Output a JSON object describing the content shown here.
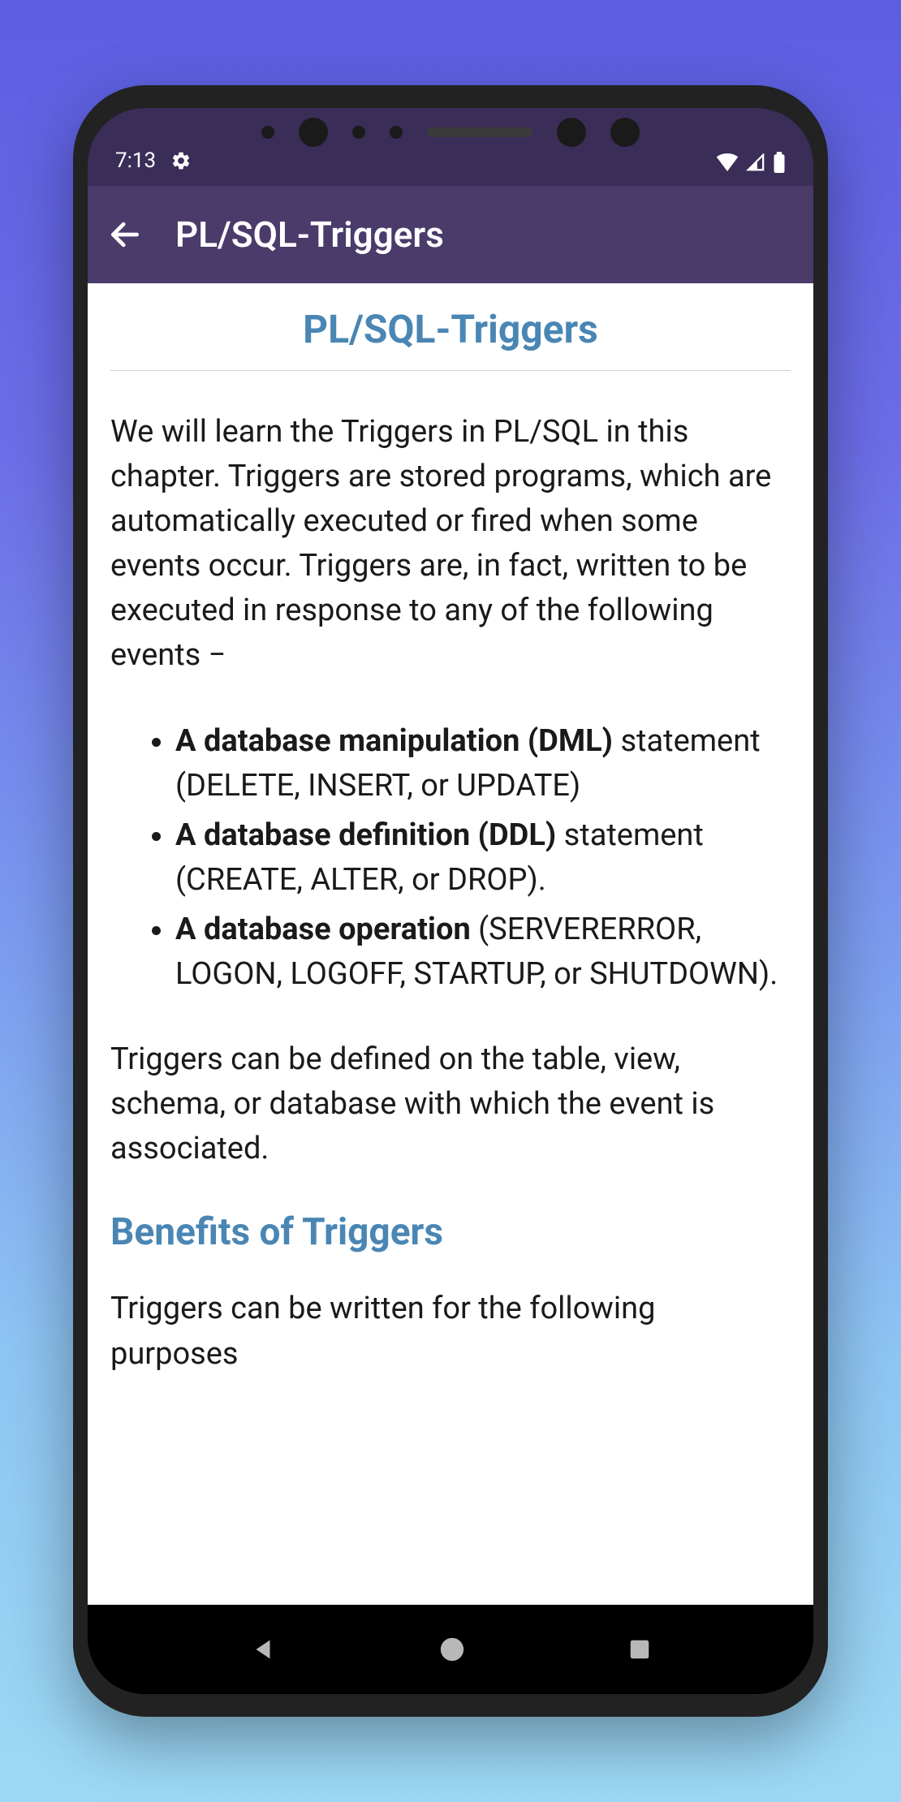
{
  "status": {
    "time": "7:13"
  },
  "appbar": {
    "title": "PL/SQL-Triggers"
  },
  "content": {
    "title": "PL/SQL-Triggers",
    "intro": "We will learn the Triggers in PL/SQL in this chapter. Triggers are stored programs, which are automatically executed or fired when some events occur. Triggers are, in fact, written to be executed in response to any of the following events −",
    "bullets": [
      {
        "bold": "A database manipulation (DML)",
        "rest": " statement (DELETE, INSERT, or UPDATE)"
      },
      {
        "bold": "A database definition (DDL)",
        "rest": " statement (CREATE, ALTER, or DROP)."
      },
      {
        "bold": "A database operation",
        "rest": " (SERVERERROR, LOGON, LOGOFF, STARTUP, or SHUTDOWN)."
      }
    ],
    "after_bullets": "Triggers can be defined on the table, view, schema, or database with which the event is associated.",
    "section_heading": "Benefits of Triggers",
    "section_intro": "Triggers can be written for the following purposes"
  }
}
